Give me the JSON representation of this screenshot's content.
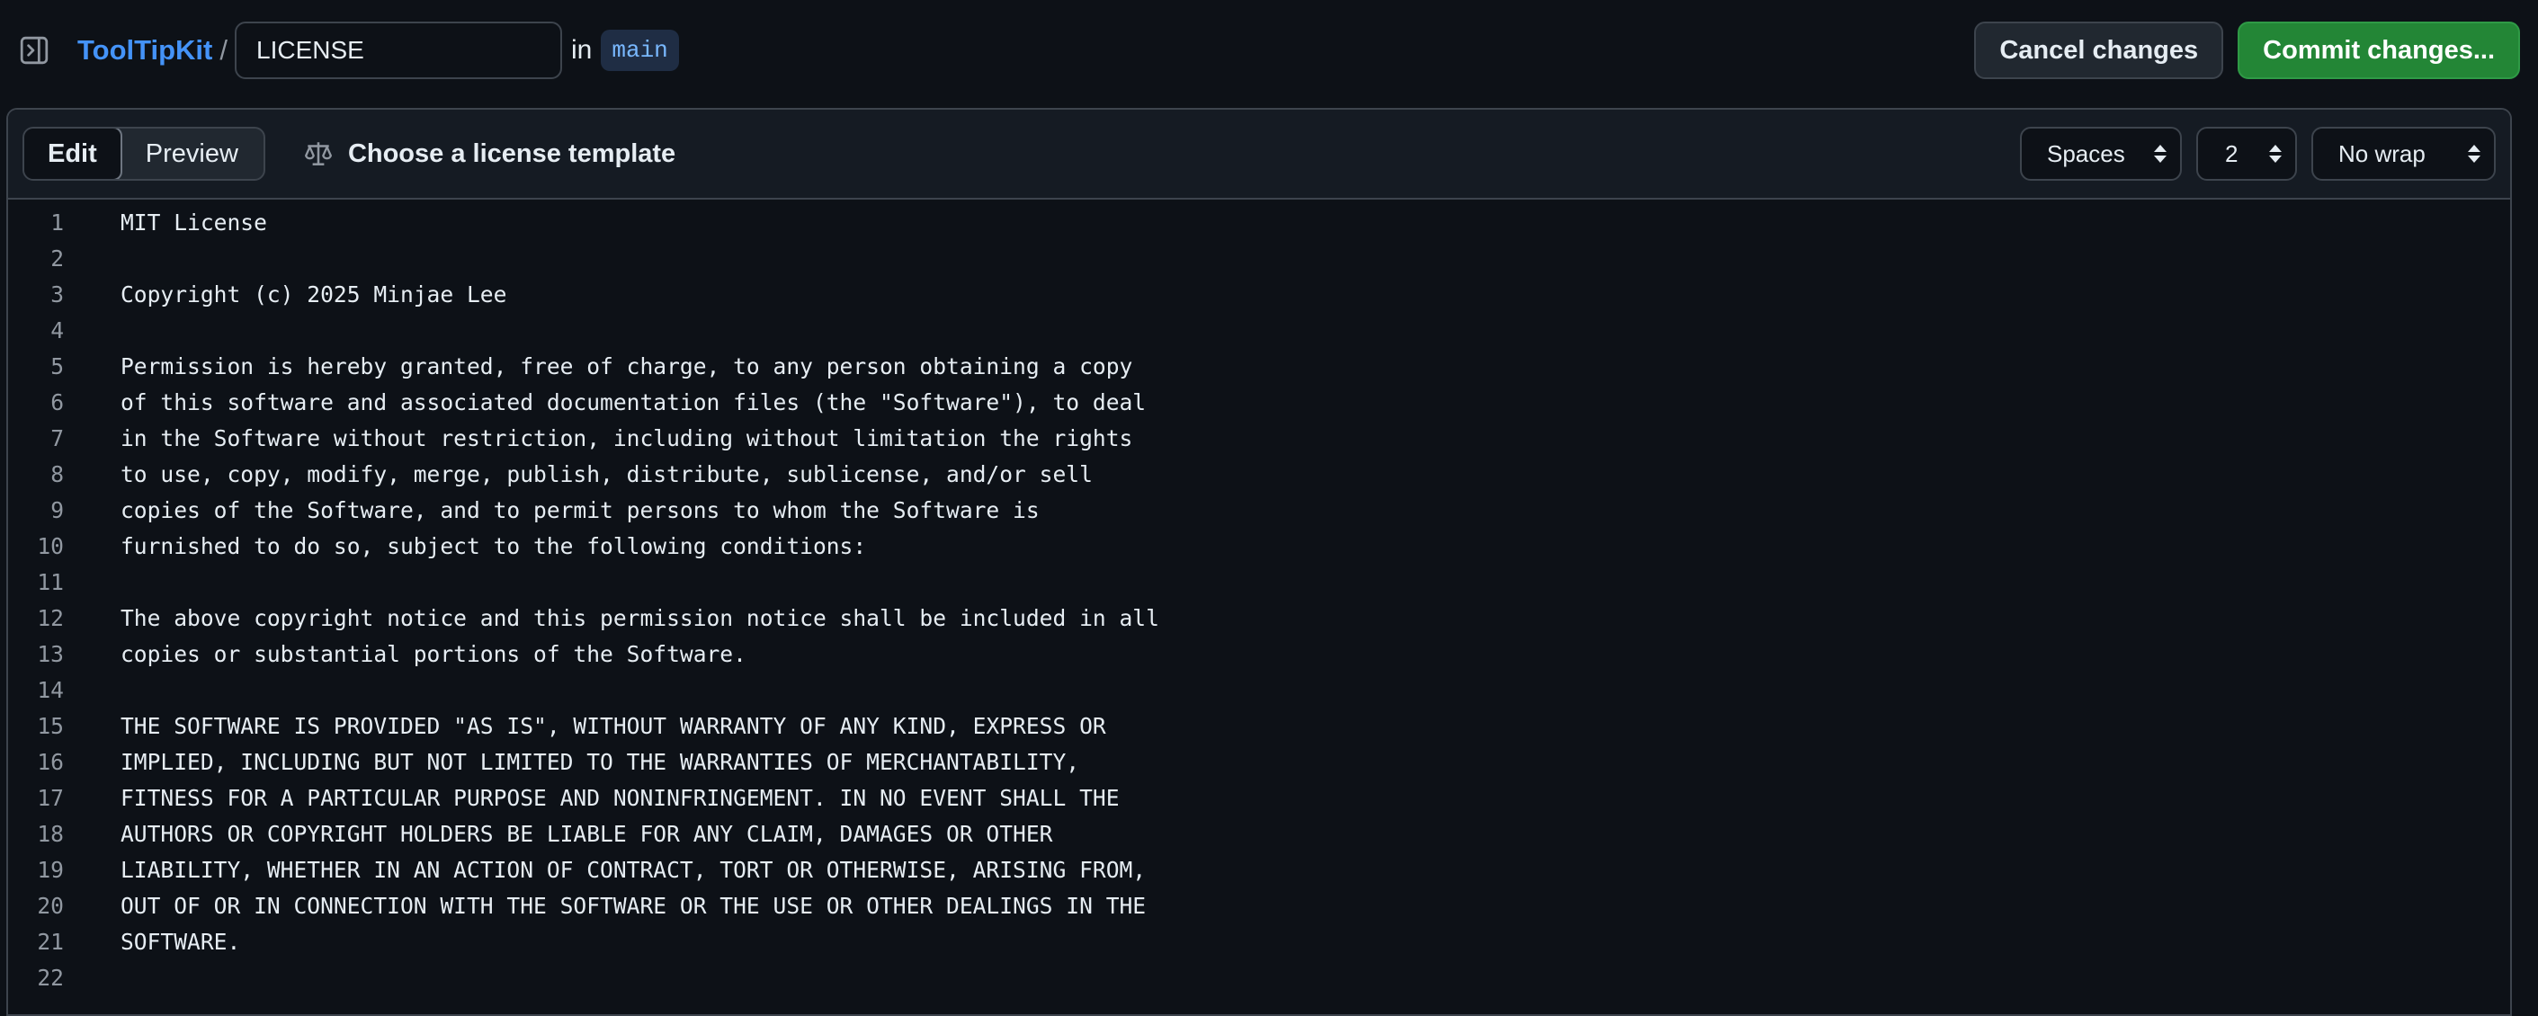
{
  "header": {
    "repo": "ToolTipKit",
    "separator": "/",
    "filename": "LICENSE",
    "in_label": "in",
    "branch": "main",
    "cancel_label": "Cancel changes",
    "commit_label": "Commit changes..."
  },
  "editor": {
    "tabs": [
      {
        "label": "Edit",
        "active": true
      },
      {
        "label": "Preview",
        "active": false
      }
    ],
    "template_label": "Choose a license template",
    "indent_mode": "Spaces",
    "indent_size": "2",
    "wrap_mode": "No wrap"
  },
  "code": {
    "lines": [
      {
        "n": "1",
        "text": "MIT License"
      },
      {
        "n": "2",
        "text": ""
      },
      {
        "n": "3",
        "text": "Copyright (c) 2025 Minjae Lee"
      },
      {
        "n": "4",
        "text": ""
      },
      {
        "n": "5",
        "text": "Permission is hereby granted, free of charge, to any person obtaining a copy"
      },
      {
        "n": "6",
        "text": "of this software and associated documentation files (the \"Software\"), to deal"
      },
      {
        "n": "7",
        "text": "in the Software without restriction, including without limitation the rights"
      },
      {
        "n": "8",
        "text": "to use, copy, modify, merge, publish, distribute, sublicense, and/or sell"
      },
      {
        "n": "9",
        "text": "copies of the Software, and to permit persons to whom the Software is"
      },
      {
        "n": "10",
        "text": "furnished to do so, subject to the following conditions:"
      },
      {
        "n": "11",
        "text": ""
      },
      {
        "n": "12",
        "text": "The above copyright notice and this permission notice shall be included in all"
      },
      {
        "n": "13",
        "text": "copies or substantial portions of the Software."
      },
      {
        "n": "14",
        "text": ""
      },
      {
        "n": "15",
        "text": "THE SOFTWARE IS PROVIDED \"AS IS\", WITHOUT WARRANTY OF ANY KIND, EXPRESS OR"
      },
      {
        "n": "16",
        "text": "IMPLIED, INCLUDING BUT NOT LIMITED TO THE WARRANTIES OF MERCHANTABILITY,"
      },
      {
        "n": "17",
        "text": "FITNESS FOR A PARTICULAR PURPOSE AND NONINFRINGEMENT. IN NO EVENT SHALL THE"
      },
      {
        "n": "18",
        "text": "AUTHORS OR COPYRIGHT HOLDERS BE LIABLE FOR ANY CLAIM, DAMAGES OR OTHER"
      },
      {
        "n": "19",
        "text": "LIABILITY, WHETHER IN AN ACTION OF CONTRACT, TORT OR OTHERWISE, ARISING FROM,"
      },
      {
        "n": "20",
        "text": "OUT OF OR IN CONNECTION WITH THE SOFTWARE OR THE USE OR OTHER DEALINGS IN THE"
      },
      {
        "n": "21",
        "text": "SOFTWARE."
      },
      {
        "n": "22",
        "text": ""
      }
    ]
  },
  "colors": {
    "background": "#0d1117",
    "repo_link": "#4493f8",
    "commit_button": "#238636",
    "branch_badge_bg": "#1f2d44",
    "branch_badge_text": "#79b8ff"
  },
  "icons": {
    "sidebar_toggle": "sidebar-expand-icon",
    "template": "law-icon",
    "select_arrows": "chevron-up-down-icon"
  }
}
